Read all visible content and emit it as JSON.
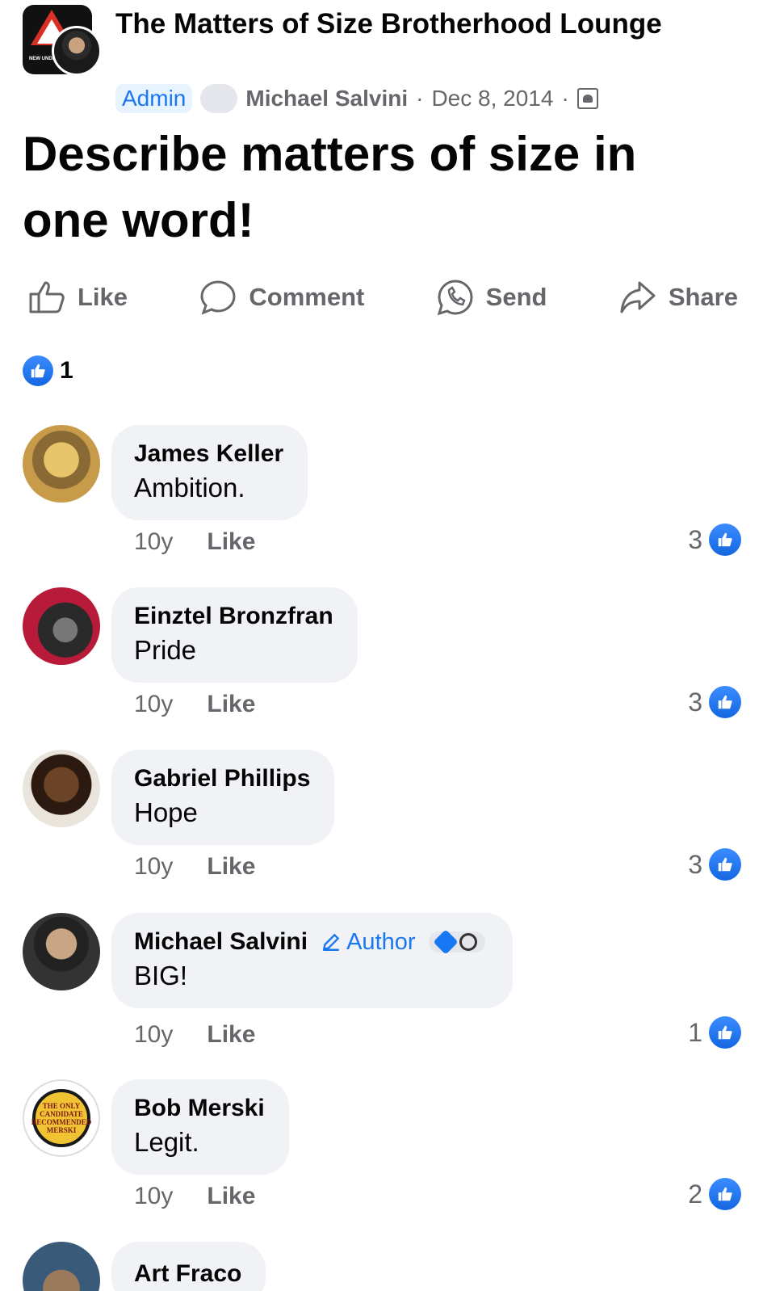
{
  "header": {
    "group_name": "The Matters of Size Brotherhood Lounge",
    "admin_badge": "Admin",
    "poster_name": "Michael Salvini",
    "separator": "·",
    "date": "Dec 8, 2014",
    "privacy_icon": "group-privacy-icon",
    "group_avatar_text": "NEW UNDER CO"
  },
  "post": {
    "title": "Describe matters of size in one word!"
  },
  "actions": [
    {
      "label": "Like",
      "icon": "thumbs-up-icon"
    },
    {
      "label": "Comment",
      "icon": "comment-icon"
    },
    {
      "label": "Send",
      "icon": "whatsapp-icon"
    },
    {
      "label": "Share",
      "icon": "share-icon"
    }
  ],
  "reactions": {
    "count": "1",
    "icon": "like-reaction-icon"
  },
  "comments": [
    {
      "name": "James Keller",
      "text": "Ambition.",
      "time": "10y",
      "like_label": "Like",
      "likes": "3"
    },
    {
      "name": "Einztel Bronzfran",
      "text": "Pride",
      "time": "10y",
      "like_label": "Like",
      "likes": "3"
    },
    {
      "name": "Gabriel Phillips",
      "text": "Hope",
      "time": "10y",
      "like_label": "Like",
      "likes": "3"
    },
    {
      "name": "Michael Salvini",
      "author_label": "Author",
      "text": "BIG!",
      "time": "10y",
      "like_label": "Like",
      "likes": "1"
    },
    {
      "name": "Bob Merski",
      "text": "Legit.",
      "time": "10y",
      "like_label": "Like",
      "likes": "2",
      "avatar_text": "THE ONLY CANDIDATE RECOMMENDED MERSKI"
    },
    {
      "name": "Art Fraco"
    }
  ],
  "colors": {
    "accent": "#1877f2",
    "bubble": "#f0f2f5",
    "muted": "#65676b"
  }
}
